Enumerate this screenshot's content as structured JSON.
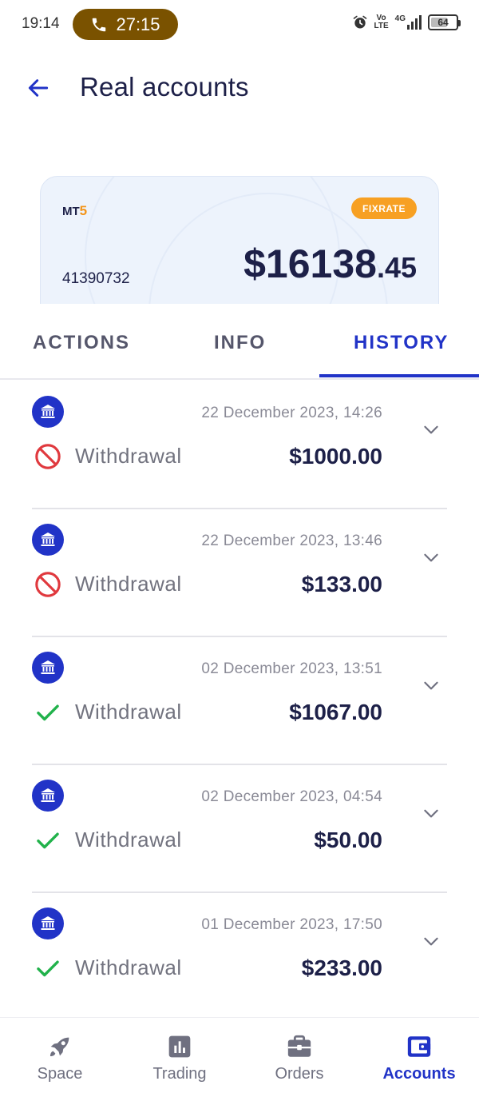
{
  "status_bar": {
    "time": "19:14",
    "call_timer": "27:15",
    "net_vo": "Vo",
    "net_lte": "LTE",
    "net_4g": "4G",
    "battery": "64",
    "icons": [
      "alarm-icon",
      "signal-icon",
      "battery-icon",
      "phone-icon"
    ]
  },
  "header": {
    "title": "Real accounts",
    "back_icon": "arrow-left-icon"
  },
  "account": {
    "platform_prefix": "MT",
    "platform_version": "5",
    "badge": "FIXRATE",
    "number": "41390732",
    "balance_main": "$16138",
    "balance_cents": ".45"
  },
  "tabs": [
    {
      "label": "ACTIONS",
      "active": false
    },
    {
      "label": "INFO",
      "active": false
    },
    {
      "label": "HISTORY",
      "active": true
    }
  ],
  "history": [
    {
      "date": "22 December 2023, 14:26",
      "type": "Withdrawal",
      "amount": "$1000.00",
      "status": "rejected"
    },
    {
      "date": "22 December 2023, 13:46",
      "type": "Withdrawal",
      "amount": "$133.00",
      "status": "rejected"
    },
    {
      "date": "02 December 2023, 13:51",
      "type": "Withdrawal",
      "amount": "$1067.00",
      "status": "completed"
    },
    {
      "date": "02 December 2023, 04:54",
      "type": "Withdrawal",
      "amount": "$50.00",
      "status": "completed"
    },
    {
      "date": "01 December 2023, 17:50",
      "type": "Withdrawal",
      "amount": "$233.00",
      "status": "completed"
    }
  ],
  "bottom_nav": [
    {
      "label": "Space",
      "icon": "rocket-icon",
      "active": false
    },
    {
      "label": "Trading",
      "icon": "bar-chart-icon",
      "active": false
    },
    {
      "label": "Orders",
      "icon": "briefcase-icon",
      "active": false
    },
    {
      "label": "Accounts",
      "icon": "wallet-icon",
      "active": true
    }
  ],
  "colors": {
    "accent": "#2133c7",
    "text_dark": "#1d2048",
    "badge": "#f7a023",
    "rejected": "#e0393e",
    "completed": "#21b24b",
    "call_pill": "#7a5200"
  }
}
